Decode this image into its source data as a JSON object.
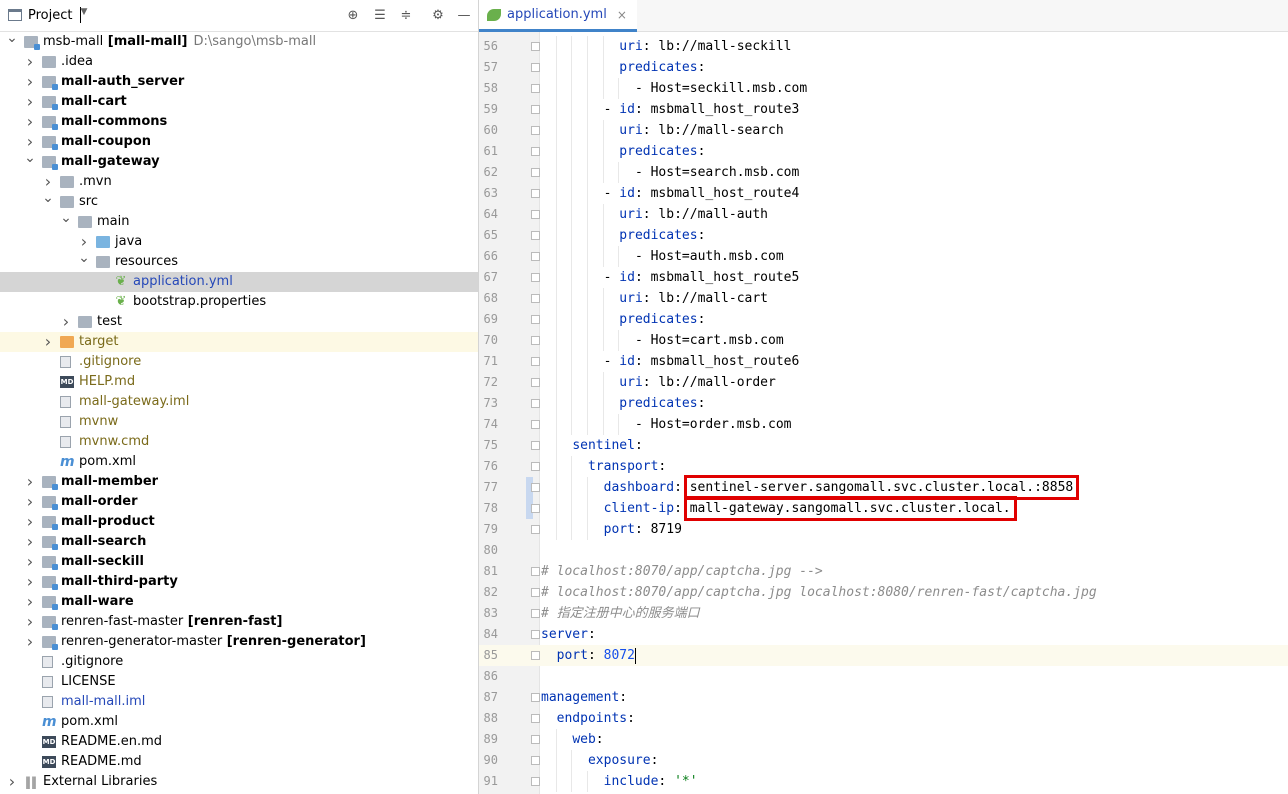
{
  "project_panel": {
    "title": "Project",
    "buttons": [
      "locate",
      "expand-all",
      "collapse-all",
      "settings",
      "hide"
    ],
    "tree": [
      {
        "label": "msb-mall",
        "bold_suffix": "[mall-mall]",
        "path": "D:\\sango\\msb-mall",
        "indent": 0,
        "arrow": "down",
        "icon": "module-folder"
      },
      {
        "label": ".idea",
        "indent": 1,
        "arrow": "right",
        "icon": "folder"
      },
      {
        "label": "mall-auth_server",
        "indent": 1,
        "arrow": "right",
        "icon": "module-folder",
        "bold": true
      },
      {
        "label": "mall-cart",
        "indent": 1,
        "arrow": "right",
        "icon": "module-folder",
        "bold": true
      },
      {
        "label": "mall-commons",
        "indent": 1,
        "arrow": "right",
        "icon": "module-folder",
        "bold": true
      },
      {
        "label": "mall-coupon",
        "indent": 1,
        "arrow": "right",
        "icon": "module-folder",
        "bold": true
      },
      {
        "label": "mall-gateway",
        "indent": 1,
        "arrow": "down",
        "icon": "module-folder",
        "bold": true
      },
      {
        "label": ".mvn",
        "indent": 2,
        "arrow": "right",
        "icon": "folder"
      },
      {
        "label": "src",
        "indent": 2,
        "arrow": "down",
        "icon": "folder"
      },
      {
        "label": "main",
        "indent": 3,
        "arrow": "down",
        "icon": "folder"
      },
      {
        "label": "java",
        "indent": 4,
        "arrow": "right",
        "icon": "folder-blue"
      },
      {
        "label": "resources",
        "indent": 4,
        "arrow": "down",
        "icon": "resources-folder"
      },
      {
        "label": "application.yml",
        "indent": 5,
        "arrow": "",
        "icon": "spring-leaf",
        "color": "blue",
        "selected": true
      },
      {
        "label": "bootstrap.properties",
        "indent": 5,
        "arrow": "",
        "icon": "spring-leaf"
      },
      {
        "label": "test",
        "indent": 3,
        "arrow": "right",
        "icon": "folder"
      },
      {
        "label": "target",
        "indent": 2,
        "arrow": "right",
        "icon": "folder-orange",
        "color": "olive",
        "highlight": true
      },
      {
        "label": ".gitignore",
        "indent": 2,
        "arrow": "",
        "icon": "file",
        "color": "olive"
      },
      {
        "label": "HELP.md",
        "indent": 2,
        "arrow": "",
        "icon": "md",
        "color": "olive"
      },
      {
        "label": "mall-gateway.iml",
        "indent": 2,
        "arrow": "",
        "icon": "file",
        "color": "olive"
      },
      {
        "label": "mvnw",
        "indent": 2,
        "arrow": "",
        "icon": "file",
        "color": "olive"
      },
      {
        "label": "mvnw.cmd",
        "indent": 2,
        "arrow": "",
        "icon": "file",
        "color": "olive"
      },
      {
        "label": "pom.xml",
        "indent": 2,
        "arrow": "",
        "icon": "maven"
      },
      {
        "label": "mall-member",
        "indent": 1,
        "arrow": "right",
        "icon": "module-folder",
        "bold": true
      },
      {
        "label": "mall-order",
        "indent": 1,
        "arrow": "right",
        "icon": "module-folder",
        "bold": true
      },
      {
        "label": "mall-product",
        "indent": 1,
        "arrow": "right",
        "icon": "module-folder",
        "bold": true
      },
      {
        "label": "mall-search",
        "indent": 1,
        "arrow": "right",
        "icon": "module-folder",
        "bold": true
      },
      {
        "label": "mall-seckill",
        "indent": 1,
        "arrow": "right",
        "icon": "module-folder",
        "bold": true
      },
      {
        "label": "mall-third-party",
        "indent": 1,
        "arrow": "right",
        "icon": "module-folder",
        "bold": true
      },
      {
        "label": "mall-ware",
        "indent": 1,
        "arrow": "right",
        "icon": "module-folder",
        "bold": true
      },
      {
        "label": "renren-fast-master",
        "bold_suffix": "[renren-fast]",
        "indent": 1,
        "arrow": "right",
        "icon": "module-folder"
      },
      {
        "label": "renren-generator-master",
        "bold_suffix": "[renren-generator]",
        "indent": 1,
        "arrow": "right",
        "icon": "module-folder"
      },
      {
        "label": ".gitignore",
        "indent": 1,
        "arrow": "",
        "icon": "file"
      },
      {
        "label": "LICENSE",
        "indent": 1,
        "arrow": "",
        "icon": "file"
      },
      {
        "label": "mall-mall.iml",
        "indent": 1,
        "arrow": "",
        "icon": "file",
        "color": "blue"
      },
      {
        "label": "pom.xml",
        "indent": 1,
        "arrow": "",
        "icon": "maven"
      },
      {
        "label": "README.en.md",
        "indent": 1,
        "arrow": "",
        "icon": "md"
      },
      {
        "label": "README.md",
        "indent": 1,
        "arrow": "",
        "icon": "md"
      },
      {
        "label": "External Libraries",
        "indent": 0,
        "arrow": "right",
        "icon": "bars"
      }
    ]
  },
  "editor": {
    "tab": {
      "label": "application.yml",
      "close": "×"
    },
    "lines": [
      {
        "n": "56",
        "indent": 10,
        "parts": [
          [
            "k",
            "uri"
          ],
          [
            "v",
            ": lb://mall-seckill"
          ]
        ]
      },
      {
        "n": "57",
        "indent": 10,
        "parts": [
          [
            "k",
            "predicates"
          ],
          [
            "v",
            ":"
          ]
        ]
      },
      {
        "n": "58",
        "indent": 12,
        "parts": [
          [
            "v",
            "- Host=seckill.msb.com"
          ]
        ]
      },
      {
        "n": "59",
        "indent": 8,
        "parts": [
          [
            "v",
            "- "
          ],
          [
            "k",
            "id"
          ],
          [
            "v",
            ": msbmall_host_route3"
          ]
        ]
      },
      {
        "n": "60",
        "indent": 10,
        "parts": [
          [
            "k",
            "uri"
          ],
          [
            "v",
            ": lb://mall-search"
          ]
        ]
      },
      {
        "n": "61",
        "indent": 10,
        "parts": [
          [
            "k",
            "predicates"
          ],
          [
            "v",
            ":"
          ]
        ]
      },
      {
        "n": "62",
        "indent": 12,
        "parts": [
          [
            "v",
            "- Host=search.msb.com"
          ]
        ]
      },
      {
        "n": "63",
        "indent": 8,
        "parts": [
          [
            "v",
            "- "
          ],
          [
            "k",
            "id"
          ],
          [
            "v",
            ": msbmall_host_route4"
          ]
        ]
      },
      {
        "n": "64",
        "indent": 10,
        "parts": [
          [
            "k",
            "uri"
          ],
          [
            "v",
            ": lb://mall-auth"
          ]
        ]
      },
      {
        "n": "65",
        "indent": 10,
        "parts": [
          [
            "k",
            "predicates"
          ],
          [
            "v",
            ":"
          ]
        ]
      },
      {
        "n": "66",
        "indent": 12,
        "parts": [
          [
            "v",
            "- Host=auth.msb.com"
          ]
        ]
      },
      {
        "n": "67",
        "indent": 8,
        "parts": [
          [
            "v",
            "- "
          ],
          [
            "k",
            "id"
          ],
          [
            "v",
            ": msbmall_host_route5"
          ]
        ]
      },
      {
        "n": "68",
        "indent": 10,
        "parts": [
          [
            "k",
            "uri"
          ],
          [
            "v",
            ": lb://mall-cart"
          ]
        ]
      },
      {
        "n": "69",
        "indent": 10,
        "parts": [
          [
            "k",
            "predicates"
          ],
          [
            "v",
            ":"
          ]
        ]
      },
      {
        "n": "70",
        "indent": 12,
        "parts": [
          [
            "v",
            "- Host=cart.msb.com"
          ]
        ]
      },
      {
        "n": "71",
        "indent": 8,
        "parts": [
          [
            "v",
            "- "
          ],
          [
            "k",
            "id"
          ],
          [
            "v",
            ": msbmall_host_route6"
          ]
        ]
      },
      {
        "n": "72",
        "indent": 10,
        "parts": [
          [
            "k",
            "uri"
          ],
          [
            "v",
            ": lb://mall-order"
          ]
        ]
      },
      {
        "n": "73",
        "indent": 10,
        "parts": [
          [
            "k",
            "predicates"
          ],
          [
            "v",
            ":"
          ]
        ]
      },
      {
        "n": "74",
        "indent": 12,
        "parts": [
          [
            "v",
            "- Host=order.msb.com"
          ]
        ]
      },
      {
        "n": "75",
        "indent": 4,
        "parts": [
          [
            "k",
            "sentinel"
          ],
          [
            "v",
            ":"
          ]
        ]
      },
      {
        "n": "76",
        "indent": 6,
        "parts": [
          [
            "k",
            "transport"
          ],
          [
            "v",
            ":"
          ]
        ]
      },
      {
        "n": "77",
        "indent": 8,
        "parts": [
          [
            "k",
            "dashboard"
          ],
          [
            "v",
            ": sentinel-server.sangomall.svc.cluster.local.:8858"
          ]
        ],
        "changed": true,
        "box": true
      },
      {
        "n": "78",
        "indent": 8,
        "parts": [
          [
            "k",
            "client-ip"
          ],
          [
            "v",
            ": mall-gateway.sangomall.svc.cluster.local."
          ]
        ],
        "changed": true,
        "box": true
      },
      {
        "n": "79",
        "indent": 8,
        "parts": [
          [
            "k",
            "port"
          ],
          [
            "v",
            ": 8719"
          ]
        ]
      },
      {
        "n": "80",
        "indent": 0,
        "parts": []
      },
      {
        "n": "81",
        "indent": 0,
        "parts": [
          [
            "c",
            "# localhost:8070/app/captcha.jpg -->"
          ]
        ]
      },
      {
        "n": "82",
        "indent": 0,
        "parts": [
          [
            "c",
            "# localhost:8070/app/captcha.jpg localhost:8080/renren-fast/captcha.jpg"
          ]
        ]
      },
      {
        "n": "83",
        "indent": 0,
        "parts": [
          [
            "c",
            "# 指定注册中心的服务端口"
          ]
        ]
      },
      {
        "n": "84",
        "indent": 0,
        "parts": [
          [
            "k",
            "server"
          ],
          [
            "v",
            ":"
          ]
        ]
      },
      {
        "n": "85",
        "indent": 2,
        "parts": [
          [
            "k",
            "port"
          ],
          [
            "v",
            ": "
          ],
          [
            "n",
            "8072"
          ]
        ],
        "current": true
      },
      {
        "n": "86",
        "indent": 0,
        "parts": []
      },
      {
        "n": "87",
        "indent": 0,
        "parts": [
          [
            "k",
            "management"
          ],
          [
            "v",
            ":"
          ]
        ]
      },
      {
        "n": "88",
        "indent": 2,
        "parts": [
          [
            "k",
            "endpoints"
          ],
          [
            "v",
            ":"
          ]
        ]
      },
      {
        "n": "89",
        "indent": 4,
        "parts": [
          [
            "k",
            "web"
          ],
          [
            "v",
            ":"
          ]
        ]
      },
      {
        "n": "90",
        "indent": 6,
        "parts": [
          [
            "k",
            "exposure"
          ],
          [
            "v",
            ":"
          ]
        ]
      },
      {
        "n": "91",
        "indent": 8,
        "parts": [
          [
            "k",
            "include"
          ],
          [
            "v",
            ": "
          ],
          [
            "q",
            "'*'"
          ]
        ]
      }
    ]
  },
  "colors": {
    "keyword": "#0033b3",
    "comment": "#8c8c8c",
    "string": "#067d17",
    "number": "#1750eb",
    "highlight_box": "#e00000"
  }
}
